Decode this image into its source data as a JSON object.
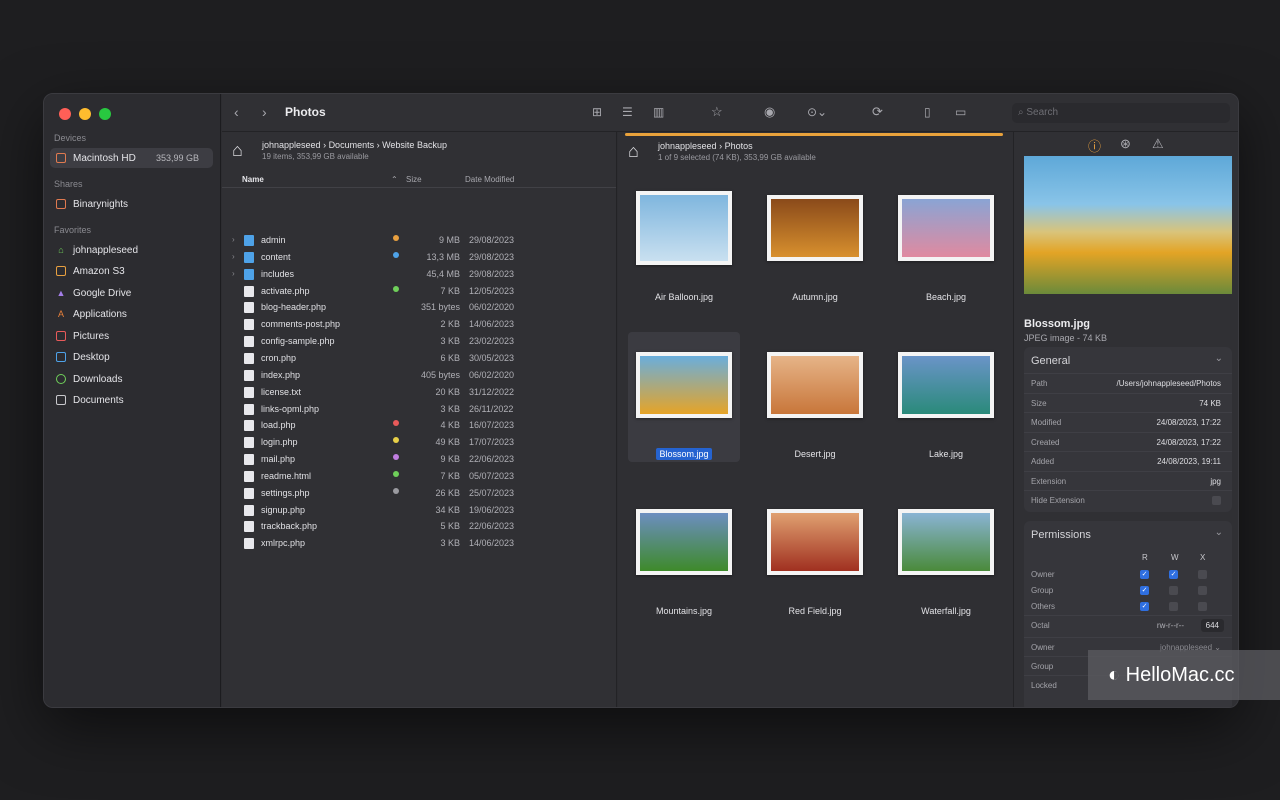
{
  "sidebar": {
    "sections": {
      "devices": "Devices",
      "shares": "Shares",
      "favorites": "Favorites"
    },
    "devices": [
      {
        "label": "Macintosh HD",
        "size": "353,99 GB"
      }
    ],
    "shares": [
      {
        "label": "Binarynights"
      }
    ],
    "favorites": [
      {
        "label": "johnappleseed"
      },
      {
        "label": "Amazon S3"
      },
      {
        "label": "Google Drive"
      },
      {
        "label": "Applications"
      },
      {
        "label": "Pictures"
      },
      {
        "label": "Desktop"
      },
      {
        "label": "Downloads"
      },
      {
        "label": "Documents"
      }
    ]
  },
  "toolbar": {
    "title": "Photos",
    "search_placeholder": "Search"
  },
  "left_pane": {
    "breadcrumb": [
      "johnappleseed",
      "Documents",
      "Website  Backup"
    ],
    "info": "19 items, 353,99 GB available",
    "columns": {
      "name": "Name",
      "size": "Size",
      "date": "Date Modified"
    },
    "files": [
      {
        "name": "admin",
        "size": "9 MB",
        "date": "29/08/2023",
        "type": "folder",
        "tag": "#e8a040"
      },
      {
        "name": "content",
        "size": "13,3 MB",
        "date": "29/08/2023",
        "type": "folder",
        "tag": "#4ea2e8"
      },
      {
        "name": "includes",
        "size": "45,4 MB",
        "date": "29/08/2023",
        "type": "folder",
        "tag": ""
      },
      {
        "name": "activate.php",
        "size": "7 KB",
        "date": "12/05/2023",
        "type": "doc",
        "tag": "#6fcf5a"
      },
      {
        "name": "blog-header.php",
        "size": "351 bytes",
        "date": "06/02/2020",
        "type": "doc",
        "tag": ""
      },
      {
        "name": "comments-post.php",
        "size": "2 KB",
        "date": "14/06/2023",
        "type": "doc",
        "tag": ""
      },
      {
        "name": "config-sample.php",
        "size": "3 KB",
        "date": "23/02/2023",
        "type": "doc",
        "tag": ""
      },
      {
        "name": "cron.php",
        "size": "6 KB",
        "date": "30/05/2023",
        "type": "doc",
        "tag": ""
      },
      {
        "name": "index.php",
        "size": "405 bytes",
        "date": "06/02/2020",
        "type": "doc",
        "tag": ""
      },
      {
        "name": "license.txt",
        "size": "20 KB",
        "date": "31/12/2022",
        "type": "doc",
        "tag": ""
      },
      {
        "name": "links-opml.php",
        "size": "3 KB",
        "date": "26/11/2022",
        "type": "doc",
        "tag": ""
      },
      {
        "name": "load.php",
        "size": "4 KB",
        "date": "16/07/2023",
        "type": "doc",
        "tag": "#e85a5a"
      },
      {
        "name": "login.php",
        "size": "49 KB",
        "date": "17/07/2023",
        "type": "doc",
        "tag": "#e8d048"
      },
      {
        "name": "mail.php",
        "size": "9 KB",
        "date": "22/06/2023",
        "type": "doc",
        "tag": "#c07ee0"
      },
      {
        "name": "readme.html",
        "size": "7 KB",
        "date": "05/07/2023",
        "type": "doc",
        "tag": "#6fcf5a"
      },
      {
        "name": "settings.php",
        "size": "26 KB",
        "date": "25/07/2023",
        "type": "doc",
        "tag": "#9a9aa0"
      },
      {
        "name": "signup.php",
        "size": "34 KB",
        "date": "19/06/2023",
        "type": "doc",
        "tag": ""
      },
      {
        "name": "trackback.php",
        "size": "5 KB",
        "date": "22/06/2023",
        "type": "doc",
        "tag": ""
      },
      {
        "name": "xmlrpc.php",
        "size": "3 KB",
        "date": "14/06/2023",
        "type": "doc",
        "tag": ""
      }
    ]
  },
  "middle_pane": {
    "breadcrumb": [
      "johnappleseed",
      "Photos"
    ],
    "info": "1 of 9 selected (74 KB), 353,99 GB available",
    "photos": [
      {
        "name": "Air Balloon.jpg",
        "selected": false,
        "colors": [
          "#7fb6de",
          "#c9e0f0"
        ]
      },
      {
        "name": "Autumn.jpg",
        "selected": false,
        "colors": [
          "#8a4a1a",
          "#d8902e"
        ]
      },
      {
        "name": "Beach.jpg",
        "selected": false,
        "colors": [
          "#8aa4d4",
          "#e08aa0"
        ]
      },
      {
        "name": "Blossom.jpg",
        "selected": true,
        "colors": [
          "#6aaedc",
          "#e6a427"
        ]
      },
      {
        "name": "Desert.jpg",
        "selected": false,
        "colors": [
          "#e6b488",
          "#c8763a"
        ]
      },
      {
        "name": "Lake.jpg",
        "selected": false,
        "colors": [
          "#6a94c8",
          "#2a8a7a"
        ]
      },
      {
        "name": "Mountains.jpg",
        "selected": false,
        "colors": [
          "#6c8ec0",
          "#3e8a2a"
        ]
      },
      {
        "name": "Red Field.jpg",
        "selected": false,
        "colors": [
          "#e0a070",
          "#a03020"
        ]
      },
      {
        "name": "Waterfall.jpg",
        "selected": false,
        "colors": [
          "#8ab4d4",
          "#4a8a3a"
        ]
      }
    ]
  },
  "inspector": {
    "file_name": "Blossom.jpg",
    "file_type": "JPEG image - 74 KB",
    "general": {
      "title": "General",
      "rows": [
        {
          "key": "Path",
          "value": "/Users/johnappleseed/Photos"
        },
        {
          "key": "Size",
          "value": "74 KB"
        },
        {
          "key": "Modified",
          "value": "24/08/2023, 17:22"
        },
        {
          "key": "Created",
          "value": "24/08/2023, 17:22"
        },
        {
          "key": "Added",
          "value": "24/08/2023, 19:11"
        },
        {
          "key": "Extension",
          "value": "jpg"
        },
        {
          "key": "Hide Extension",
          "value": ""
        }
      ]
    },
    "permissions": {
      "title": "Permissions",
      "cols": [
        "R",
        "W",
        "X"
      ],
      "rows": [
        {
          "key": "Owner",
          "r": true,
          "w": true,
          "x": false
        },
        {
          "key": "Group",
          "r": true,
          "w": false,
          "x": false
        },
        {
          "key": "Others",
          "r": true,
          "w": false,
          "x": false
        }
      ],
      "octal_label": "Octal",
      "octal_string": "rw-r--r--",
      "octal_value": "644",
      "owner_label": "Owner",
      "owner_value": "johnappleseed",
      "group_label": "Group",
      "locked_label": "Locked"
    }
  },
  "watermark": "HelloMac.cc"
}
